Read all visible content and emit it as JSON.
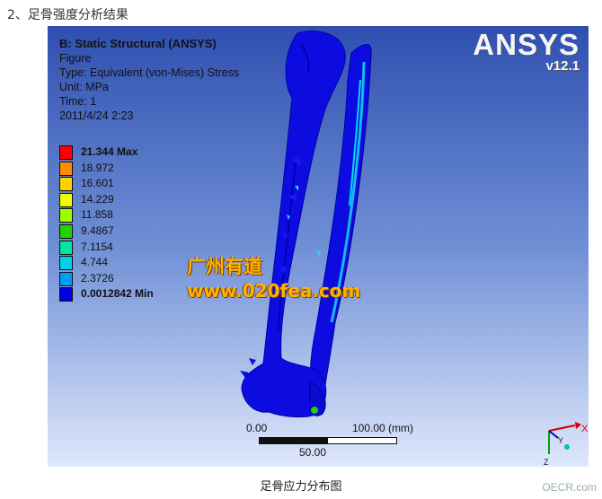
{
  "heading": "2、足骨强度分析结果",
  "info": {
    "title": "B: Static Structural (ANSYS)",
    "line1": "Figure",
    "line2": "Type: Equivalent (von-Mises) Stress",
    "line3": "Unit: MPa",
    "line4": "Time: 1",
    "line5": "2011/4/24 2:23"
  },
  "legend": [
    {
      "label": "21.344 Max",
      "color": "#ff0000",
      "bold": true
    },
    {
      "label": "18.972",
      "color": "#ff8c00"
    },
    {
      "label": "16.601",
      "color": "#ffd200"
    },
    {
      "label": "14.229",
      "color": "#f0ff00"
    },
    {
      "label": "11.858",
      "color": "#9cff00"
    },
    {
      "label": "9.4867",
      "color": "#22d100"
    },
    {
      "label": "7.1154",
      "color": "#00e5a0"
    },
    {
      "label": "4.744",
      "color": "#00d0e8"
    },
    {
      "label": "2.3726",
      "color": "#0099ff"
    },
    {
      "label": "0.0012842 Min",
      "color": "#0000e0",
      "bold": true
    }
  ],
  "logo": {
    "brand": "ANSYS",
    "version": "v12.1"
  },
  "watermark": {
    "line1": "广州有道",
    "line2": "www.020fea.com"
  },
  "scale": {
    "start": "0.00",
    "end": "100.00 (mm)",
    "mid": "50.00"
  },
  "triad": {
    "x": "X",
    "y": "Y",
    "z": "Z"
  },
  "caption": "足骨应力分布图",
  "corner": "OECR.com"
}
